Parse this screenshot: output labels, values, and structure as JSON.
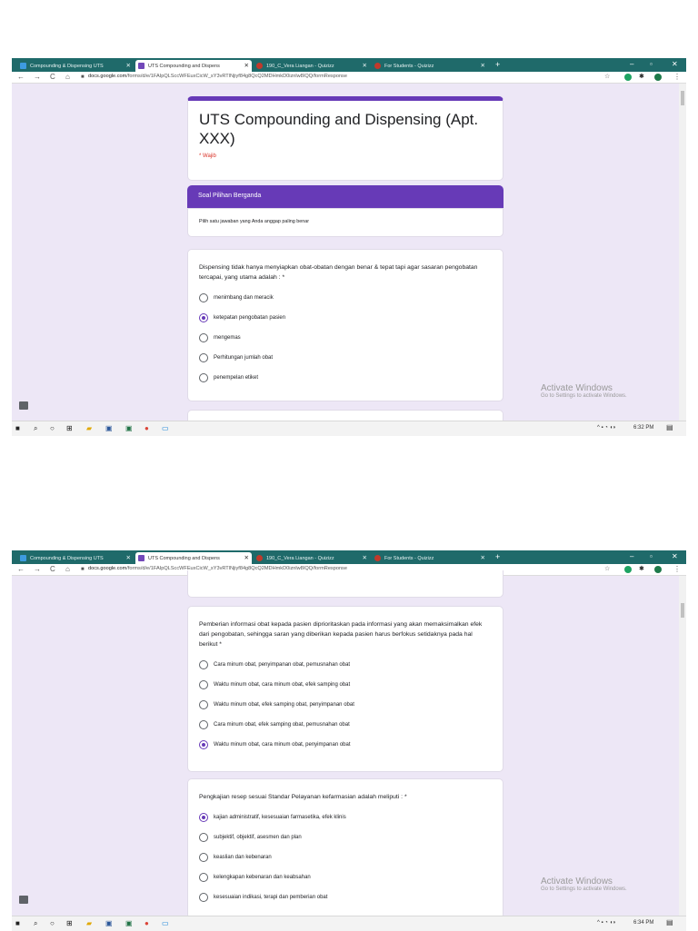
{
  "browser": {
    "tabs": [
      {
        "label": "Compounding & Dispensing UTS",
        "active": false,
        "favicon": "classroom-icon"
      },
      {
        "label": "UTS Compounding and Dispens",
        "active": true,
        "favicon": "forms-icon"
      },
      {
        "label": "190_C_Vera Liangan - Quizizz",
        "active": false,
        "favicon": "quizizz-icon"
      },
      {
        "label": "For Students - Quizizz",
        "active": false,
        "favicon": "quizizz-icon"
      }
    ],
    "url_domain": "docs.google.com",
    "url_path": "/forms/d/e/1FAIpQLSccWFEuxCicW_sY3vRTlNjiyf84g8QcQ2MDHmkD0iznlw8IQQ/formResponse"
  },
  "form": {
    "title": "UTS Compounding and Dispensing (Apt. XXX)",
    "required_note": "* Wajib",
    "section_title": "Soal Pilihan Berganda",
    "section_desc": "Pilih satu jawaban yang Anda anggap paling benar"
  },
  "questions": [
    {
      "text": "Dispensing tidak hanya menyiapkan obat-obatan dengan benar & tepat tapi agar sasaran pengobatan tercapai, yang utama adalah : *",
      "options": [
        "menimbang dan meracik",
        "ketepatan pengobatan pasien",
        "mengemas",
        "Perhitungan jumlah obat",
        "penempelan etiket"
      ],
      "selected": 1
    },
    {
      "text": "Pemberian informasi obat kepada pasien diprioritaskan pada informasi yang akan memaksimalkan efek dari pengobatan, sehingga saran yang diberikan kepada pasien harus berfokus setidaknya pada hal berikut *",
      "options": [
        "Cara minum obat, penyimpanan obat, pemusnahan obat",
        "Waktu minum obat, cara minum obat, efek samping obat",
        "Waktu minum obat, efek samping obat, penyimpanan obat",
        "Cara minum obat, efek samping obat, pemusnahan obat",
        "Waktu minum obat, cara minum obat, penyimpanan obat"
      ],
      "selected": 4
    },
    {
      "text": "Pengkajian resep sesuai Standar Pelayanan kefarmasian adalah meliputi : *",
      "options": [
        "kajian administratif, kesesuaian farmasetika, efek klinis",
        "subjektif, objektif, asesmen dan plan",
        "keaslian dan kebenaran",
        "kelengkapan kebenaran dan keabsahan",
        "kesesuaian indikasi, terapi dan pemberian obat"
      ],
      "selected": 0
    }
  ],
  "watermark": {
    "line1": "Activate Windows",
    "line2": "Go to Settings to activate Windows."
  },
  "taskbar": {
    "clock1": "6:32 PM",
    "clock2": "6:34 PM"
  },
  "colors": {
    "accent": "#673ab7",
    "background": "#ede7f6",
    "tabstrip": "#1f6a6a"
  }
}
